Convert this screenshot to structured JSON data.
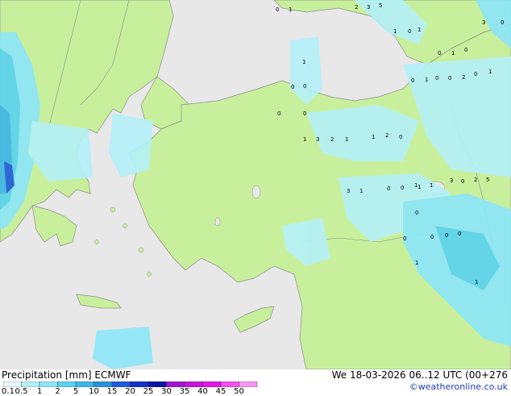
{
  "footer": {
    "title": "Precipitation [mm]  ECMWF",
    "valid": "We 18-03-2026 06..12 UTC (00+276",
    "credit": "©weatheronline.co.uk"
  },
  "legend": {
    "levels": [
      {
        "label": "0.1",
        "color": "#e8fafc"
      },
      {
        "label": "0.5",
        "color": "#b4f0f8"
      },
      {
        "label": "1",
        "color": "#8ce6f8"
      },
      {
        "label": "2",
        "color": "#5ad2f0"
      },
      {
        "label": "5",
        "color": "#3cb4e8"
      },
      {
        "label": "10",
        "color": "#2890dc"
      },
      {
        "label": "15",
        "color": "#1e5adc"
      },
      {
        "label": "20",
        "color": "#1432c8"
      },
      {
        "label": "25",
        "color": "#0a14a0"
      },
      {
        "label": "30",
        "color": "#a014d2"
      },
      {
        "label": "35",
        "color": "#c814dc"
      },
      {
        "label": "40",
        "color": "#e614e6"
      },
      {
        "label": "45",
        "color": "#f050f0"
      },
      {
        "label": "50",
        "color": "#f496f4"
      }
    ]
  },
  "map": {
    "colors": {
      "land": "#c8f09c",
      "sea": "#e8e8e8",
      "border": "#8c8c8c"
    },
    "value_labels": [
      "0",
      "1",
      "2",
      "3",
      "5",
      "1",
      "0",
      "1",
      "3",
      "0",
      "0",
      "1",
      "0",
      "1",
      "0",
      "0",
      "0",
      "1",
      "0",
      "0",
      "2",
      "0",
      "1",
      "0",
      "0",
      "1",
      "3",
      "2",
      "1",
      "1",
      "2",
      "0",
      "1",
      "3",
      "0",
      "2",
      "5",
      "3",
      "1",
      "0",
      "0",
      "1",
      "1",
      "0",
      "0",
      "0",
      "0",
      "0",
      "1",
      "1"
    ]
  }
}
